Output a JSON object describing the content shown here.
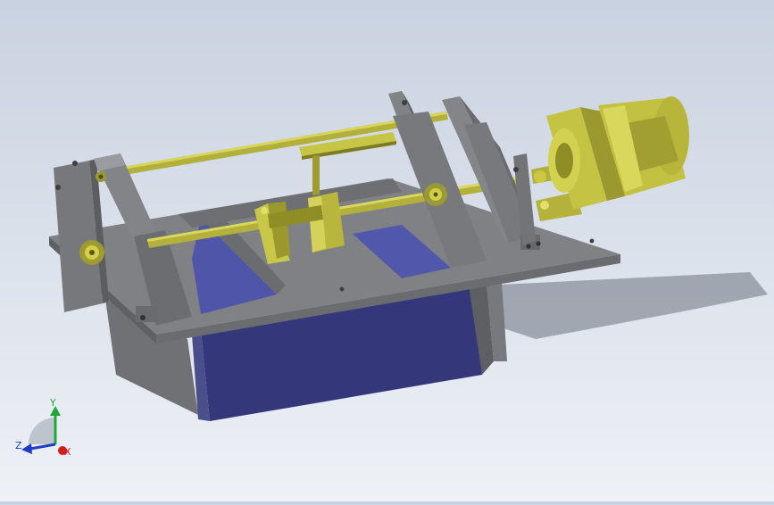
{
  "viewport": {
    "colors": {
      "background_top": "#c9d2e0",
      "background_bottom": "#eef1f6",
      "frame_gray": "#7d7f82",
      "frame_gray_light": "#96989b",
      "frame_gray_dark": "#5a5c5f",
      "container_blue": "#3e4690",
      "container_blue_light": "#5a60b6",
      "part_yellow": "#b6b43a",
      "part_yellow_light": "#d6d44f",
      "part_yellow_dark": "#7e7c1e"
    }
  },
  "triad": {
    "x_label": "X",
    "y_label": "Y",
    "z_label": "Z",
    "x_color": "#d11e1e",
    "y_color": "#1ea83a",
    "z_color": "#1e3cc8"
  }
}
